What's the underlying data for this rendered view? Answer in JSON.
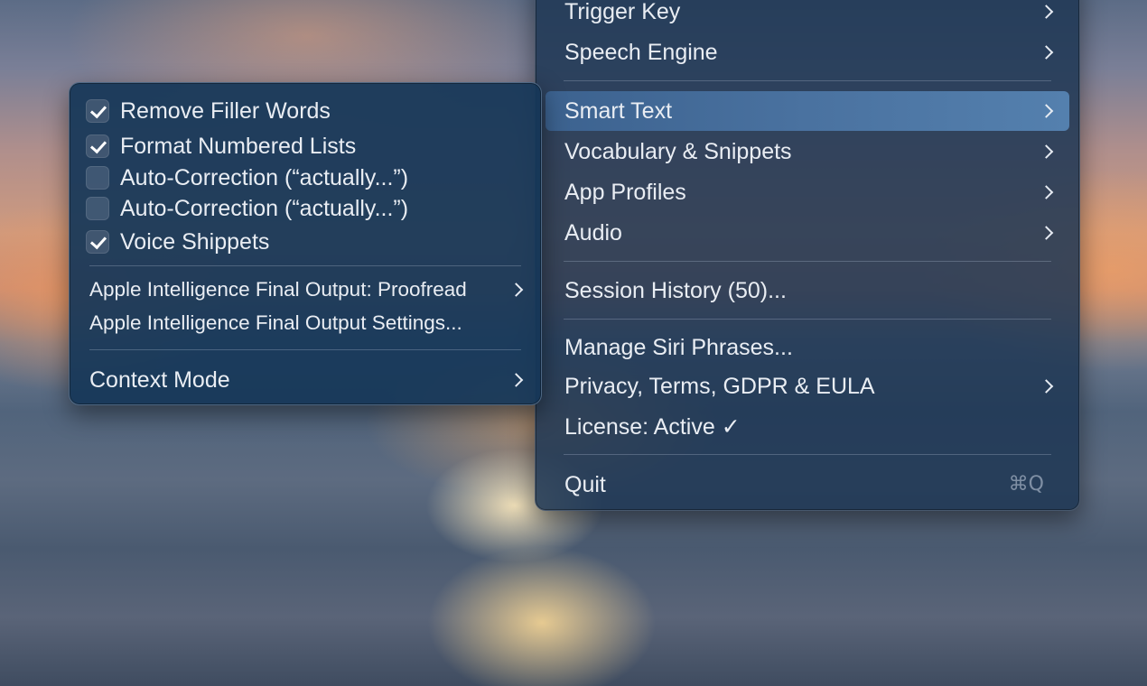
{
  "main_menu": {
    "items": [
      {
        "label": "Trigger Key"
      },
      {
        "label": "Speech Engine"
      },
      {
        "label": "Smart Text"
      },
      {
        "label": "Vocabulary & Snippets"
      },
      {
        "label": "App Profiles"
      },
      {
        "label": "Audio"
      },
      {
        "label": "Session History (50)..."
      },
      {
        "label": "Manage Siri Phrases..."
      },
      {
        "label": "Privacy, Terms, GDPR & EULA"
      },
      {
        "label": "License: Active ✓"
      },
      {
        "label": "Quit",
        "shortcut": "⌘Q"
      }
    ]
  },
  "smart_text_submenu": {
    "checkboxes": [
      {
        "label": "Remove Filler Words",
        "checked": true
      },
      {
        "label": "Format Numbered Lists",
        "checked": true
      },
      {
        "label": "Auto-Correction (“actually...”)",
        "checked": false
      },
      {
        "label": "Auto-Correction (“actually...”)",
        "checked": false
      },
      {
        "label": "Voice Shippets",
        "checked": true
      }
    ],
    "ai_output": "Apple Intelligence Final Output: Proofread",
    "ai_settings": "Apple Intelligence Final Output Settings...",
    "context_mode": "Context Mode"
  },
  "colors": {
    "highlight": "#4a72a0",
    "menu_bg": "#1e3754",
    "text": "#e9edf3"
  }
}
